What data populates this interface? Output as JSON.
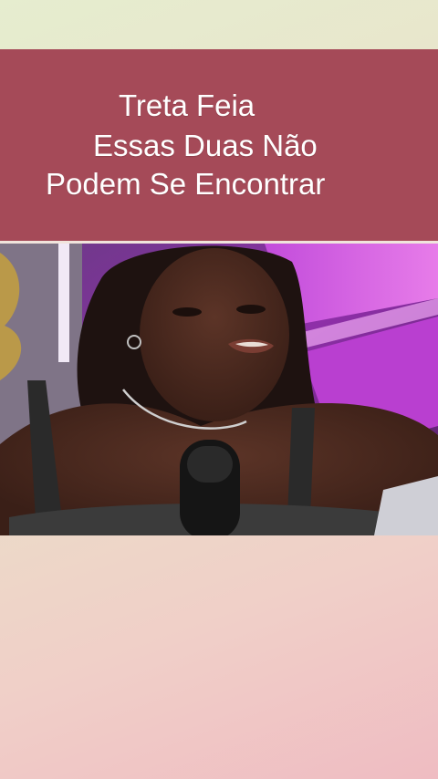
{
  "title": {
    "line1": "Treta Feia",
    "line2": "Essas Duas Não",
    "line3": "Podem Se Encontrar"
  },
  "colors": {
    "banner": "#a54a58",
    "title_text": "#ffffff",
    "backdrop_purple": "#b93fd0"
  },
  "video": {
    "scene": "person-speaking-into-microphone"
  }
}
